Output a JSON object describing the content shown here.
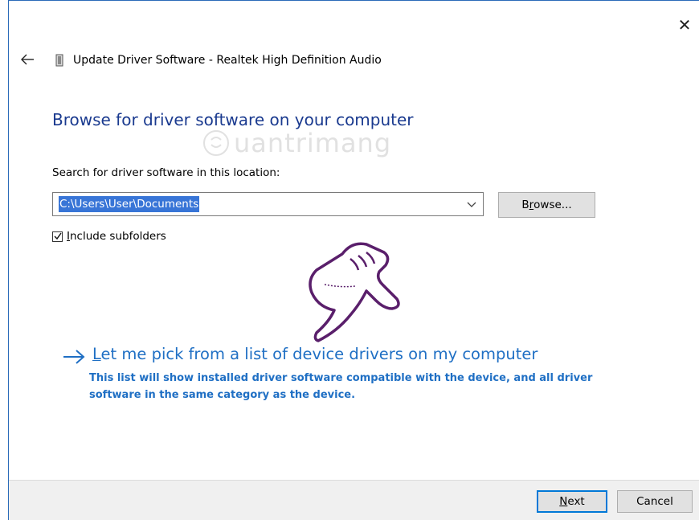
{
  "window": {
    "title": "Update Driver Software - Realtek High Definition Audio",
    "close_glyph": "✕",
    "back_icon": "back-arrow-icon",
    "device_icon": "audio-device-icon"
  },
  "main": {
    "heading": "Browse for driver software on your computer",
    "search_label": "Search for driver software in this location:",
    "path_value": "C:\\Users\\User\\Documents",
    "browse_button": {
      "prefix": "B",
      "accel": "r",
      "suffix": "owse..."
    },
    "include_subfolders": {
      "checked": true,
      "accel": "I",
      "rest": "nclude subfolders"
    },
    "pick_link": {
      "accel": "L",
      "rest": "et me pick from a list of device drivers on my computer",
      "description": "This list will show installed driver software compatible with the device, and all driver software in the same category as the device."
    }
  },
  "watermark": {
    "text": "uantrimang"
  },
  "footer": {
    "next": {
      "accel": "N",
      "rest": "ext"
    },
    "cancel": "Cancel"
  },
  "colors": {
    "heading": "#1a3a8f",
    "link": "#1f6fc4",
    "selection": "#3875d7",
    "hand": "#5a1f6b"
  }
}
